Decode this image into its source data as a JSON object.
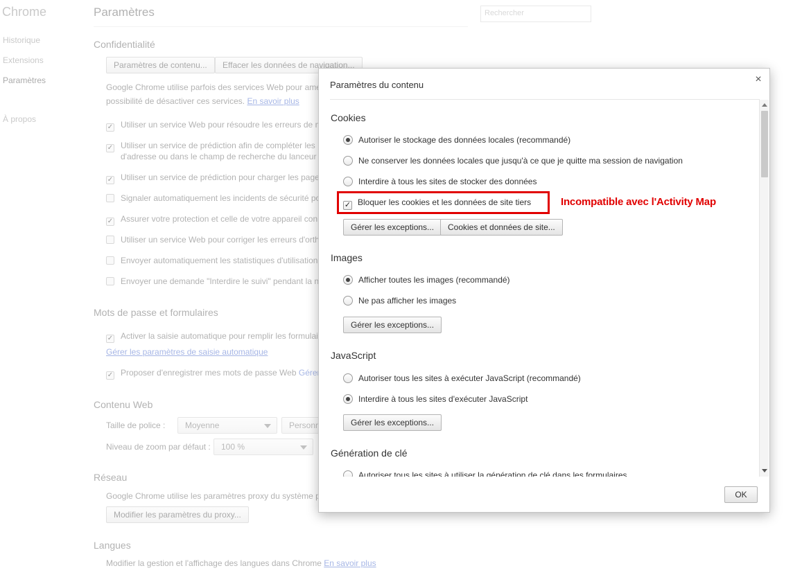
{
  "app": {
    "title": "Chrome"
  },
  "sidebar": {
    "items": [
      {
        "label": "Historique"
      },
      {
        "label": "Extensions"
      },
      {
        "label": "Paramètres"
      },
      {
        "label": "À propos"
      }
    ]
  },
  "page": {
    "title": "Paramètres",
    "search_placeholder": "Rechercher",
    "privacy": {
      "heading": "Confidentialité",
      "btn_content": "Paramètres de contenu...",
      "btn_clear": "Effacer les données de navigation...",
      "desc_line1": "Google Chrome utilise parfois des services Web pour amé",
      "desc_line2": "possibilité de désactiver ces services.",
      "learn_more": "En savoir plus",
      "checks": [
        {
          "label": "Utiliser un service Web pour résoudre les erreurs de n",
          "checked": true
        },
        {
          "label": "Utiliser un service de prédiction afin de compléter les",
          "checked": true
        },
        {
          "label": "d'adresse ou dans le champ de recherche du lanceur d",
          "checked": false
        },
        {
          "label": "Utiliser un service de prédiction pour charger les page",
          "checked": true
        },
        {
          "label": "Signaler automatiquement les incidents de sécurité pot",
          "checked": false
        },
        {
          "label": "Assurer votre protection et celle de votre appareil con",
          "checked": true
        },
        {
          "label": "Utiliser un service Web pour corriger les erreurs d'orth",
          "checked": false
        },
        {
          "label": "Envoyer automatiquement les statistiques d'utilisation",
          "checked": false
        },
        {
          "label": "Envoyer une demande \"Interdire le suivi\" pendant la n",
          "checked": false
        }
      ]
    },
    "passwords": {
      "heading": "Mots de passe et formulaires",
      "autofill": "Activer la saisie automatique pour remplir les formulai",
      "autofill_link": "Gérer les paramètres de saisie automatique",
      "save_pw": "Proposer d'enregistrer mes mots de passe Web",
      "save_pw_link": "Gérer"
    },
    "webcontent": {
      "heading": "Contenu Web",
      "font_label": "Taille de police :",
      "font_value": "Moyenne",
      "font_custom": "Personn",
      "zoom_label": "Niveau de zoom par défaut :",
      "zoom_value": "100 %"
    },
    "network": {
      "heading": "Réseau",
      "desc": "Google Chrome utilise les paramètres proxy du système p",
      "btn_proxy": "Modifier les paramètres du proxy..."
    },
    "languages": {
      "heading": "Langues",
      "desc": "Modifier la gestion et l'affichage des langues dans Chrome",
      "learn_more": "En savoir plus"
    }
  },
  "dialog": {
    "title": "Paramètres du contenu",
    "close_glyph": "×",
    "cookies": {
      "heading": "Cookies",
      "options": [
        {
          "label": "Autoriser le stockage des données locales (recommandé)",
          "selected": true
        },
        {
          "label": "Ne conserver les données locales que jusqu'à ce que je quitte ma session de navigation",
          "selected": false
        },
        {
          "label": "Interdire à tous les sites de stocker des données",
          "selected": false
        }
      ],
      "block_third_party": "Bloquer les cookies et les données de site tiers",
      "block_third_party_checked": true,
      "btn_exceptions": "Gérer les exceptions...",
      "btn_cookies_data": "Cookies et données de site..."
    },
    "annotation": "Incompatible avec l'Activity Map",
    "images": {
      "heading": "Images",
      "options": [
        {
          "label": "Afficher toutes les images (recommandé)",
          "selected": true
        },
        {
          "label": "Ne pas afficher les images",
          "selected": false
        }
      ],
      "btn_exceptions": "Gérer les exceptions..."
    },
    "javascript": {
      "heading": "JavaScript",
      "options": [
        {
          "label": "Autoriser tous les sites à exécuter JavaScript (recommandé)",
          "selected": false
        },
        {
          "label": "Interdire à tous les sites d'exécuter JavaScript",
          "selected": true
        }
      ],
      "btn_exceptions": "Gérer les exceptions..."
    },
    "keygen": {
      "heading": "Génération de clé",
      "option_partial": "Autoriser tous les sites à utiliser la génération de clé dans les formulaires"
    },
    "ok_label": "OK"
  },
  "colors": {
    "annotation_red": "#e10000",
    "link_blue": "#3a5dc7"
  }
}
